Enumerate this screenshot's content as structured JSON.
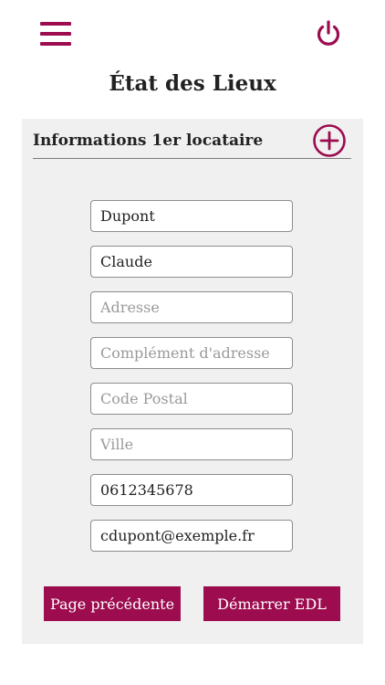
{
  "colors": {
    "accent": "#9c0c4f",
    "panel_bg": "#f0f0f0"
  },
  "header": {
    "menu_icon": "hamburger-menu-icon",
    "power_icon": "power-icon",
    "title": "État des Lieux"
  },
  "section": {
    "title": "Informations 1er locataire",
    "add_icon": "plus-circle-icon"
  },
  "form": {
    "nom": {
      "value": "Dupont",
      "placeholder": ""
    },
    "prenom": {
      "value": "Claude",
      "placeholder": ""
    },
    "adresse": {
      "value": "",
      "placeholder": "Adresse"
    },
    "complement": {
      "value": "",
      "placeholder": "Complément d'adresse"
    },
    "code_postal": {
      "value": "",
      "placeholder": "Code Postal"
    },
    "ville": {
      "value": "",
      "placeholder": "Ville"
    },
    "telephone": {
      "value": "0612345678",
      "placeholder": ""
    },
    "email": {
      "value": "cdupont@exemple.fr",
      "placeholder": ""
    }
  },
  "actions": {
    "previous_label": "Page précédente",
    "start_label": "Démarrer EDL"
  }
}
